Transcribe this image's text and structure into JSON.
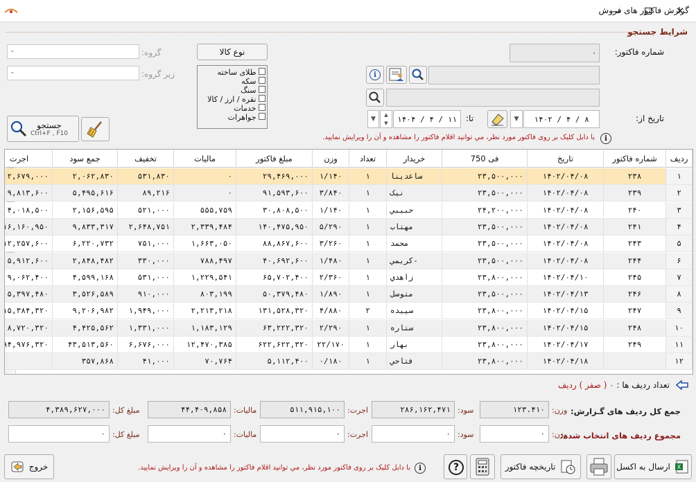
{
  "window": {
    "title": "گزارش فاکتور های فروش"
  },
  "search_section": {
    "title": "شرايط جستجو"
  },
  "filters": {
    "invoice_no_label": "شماره فاکتور:",
    "invoice_no_value": "0",
    "date_from_label": "تاريخ از:",
    "date_from_value": "1402 / 4 / 8",
    "date_to_label": "تا:",
    "date_to_value": "1404 / 4 / 11",
    "group_label": "گروه:",
    "subgroup_label": "زير گروه:",
    "goods_type_button": "نوع کالا",
    "goods_types": [
      "طلای ساخته",
      "سکه",
      "سنگ",
      "نقره / ارز / کالا",
      "خدمات",
      "جواهرات"
    ],
    "search_button": "جستجو",
    "search_shortcut": "Ctrl+F , F10",
    "hint": "با دابل کليک بر روی فاکتور مورد نظر، مي توانيد اقلام فاکتور را مشاهده و آن را ويرايش نماييد."
  },
  "table": {
    "headers": [
      "رديف",
      "شماره فاکتور",
      "تاريخ",
      "فی 750",
      "خريدار",
      "تعداد",
      "وزن",
      "مبلغ فاکتور",
      "ماليات",
      "تخفيف",
      "جمع سود",
      "اجرت"
    ],
    "rows": [
      [
        "1",
        "238",
        "1402/04/08",
        "23,500,000",
        "ساعدينا",
        "1",
        "1/140",
        "29,469,000",
        "0",
        "531,830",
        "2,062,830",
        "2,679,000"
      ],
      [
        "2",
        "239",
        "1402/04/08",
        "23,500,000",
        "نيک",
        "1",
        "3/840",
        "91,593,600",
        "0",
        "89,216",
        "5,495,616",
        "9,813,600"
      ],
      [
        "3",
        "240",
        "1402/04/08",
        "24,200,000",
        "حبيبي",
        "1",
        "1/140",
        "30,808,500",
        "555,759",
        "521,000",
        "2,156,595",
        "4,018,500"
      ],
      [
        "4",
        "241",
        "1402/04/08",
        "23,500,000",
        "مهتاب",
        "1",
        "5/290",
        "140,475,950",
        "2,339,484",
        "2,648,751",
        "9,833,317",
        "16,160,950"
      ],
      [
        "5",
        "243",
        "1402/04/08",
        "23,500,000",
        "محمد",
        "1",
        "3/260",
        "88,867,600",
        "1,663,050",
        "751,000",
        "6,220,732",
        "12,257,600"
      ],
      [
        "6",
        "244",
        "1402/04/08",
        "23,500,000",
        "کريمي-",
        "1",
        "1/480",
        "40,692,600",
        "788,497",
        "330,000",
        "2,848,482",
        "5,912,600"
      ],
      [
        "7",
        "245",
        "1402/04/10",
        "23,800,000",
        "زاهدي",
        "1",
        "2/360",
        "65,702,400",
        "1,229,541",
        "531,000",
        "4,599,168",
        "9,062,400"
      ],
      [
        "8",
        "246",
        "1402/04/13",
        "23,500,000",
        "متوسل",
        "1",
        "1/890",
        "50,379,480",
        "803,199",
        "910,000",
        "3,526,589",
        "5,397,480"
      ],
      [
        "9",
        "247",
        "1402/04/15",
        "23,800,000",
        "سپيده",
        "2",
        "4/880",
        "131,528,320",
        "2,213,218",
        "1,949,000",
        "9,206,982",
        "15,384,320"
      ],
      [
        "10",
        "248",
        "1402/04/15",
        "23,800,000",
        "ستاره",
        "1",
        "2/290",
        "63,222,320",
        "1,183,129",
        "1,331,000",
        "4,425,562",
        "8,720,320"
      ],
      [
        "11",
        "249",
        "1402/04/17",
        "23,800,000",
        "بهار",
        "1",
        "22/170",
        "622,622,320",
        "12,470,385",
        "6,676,000",
        "43,513,560",
        "94,976,320"
      ],
      [
        "12",
        "",
        "1402/04/18",
        "23,800,000",
        "فتاحي",
        "1",
        "0/180",
        "5,112,400",
        "70,764",
        "41,000",
        "357,868",
        ""
      ]
    ]
  },
  "row_count": {
    "label": "تعداد رديف ها :",
    "value": "0 ( صفر ) رديف"
  },
  "totals": {
    "all_label": "جمع کل رديف های گـزارش:",
    "selected_label": "مجموع رديف های انتخاب شده:",
    "weight_label": "وزن:",
    "profit_label": "سود:",
    "wage_label": "اجرت:",
    "tax_label": "ماليات:",
    "total_amount_label": "مبلغ کل:",
    "all": {
      "weight": "123.410",
      "profit": "286,162,471",
      "wage": "511,915,100",
      "tax": "44,409,858",
      "total_amount": "4,389,627,000"
    },
    "selected": {
      "weight": "0",
      "profit": "0",
      "wage": "0",
      "tax": "0",
      "total_amount": "0"
    }
  },
  "footer": {
    "excel_button": "ارسال به اکسل",
    "history_button": "تاريخچه فاکتور",
    "exit_button": "خروج",
    "hint": "با دابل کليک بر روی فاکتور مورد نظر، مي توانيد اقلام فاکتور را مشاهده و آن را ويرايش نماييد."
  },
  "colors": {
    "selected_row": "#fde7b8",
    "alt_row": "#f0f0f0",
    "section_title": "#7a2a18",
    "hint_red": "#b01818"
  }
}
